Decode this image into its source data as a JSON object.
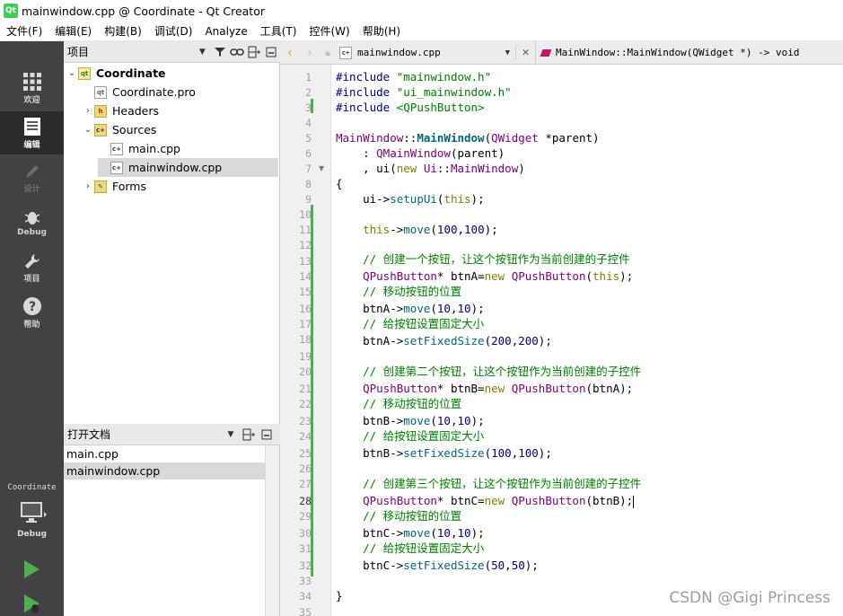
{
  "window": {
    "title": "mainwindow.cpp @ Coordinate - Qt Creator",
    "logo_text": "Qt"
  },
  "menu": [
    "文件(F)",
    "编辑(E)",
    "构建(B)",
    "调试(D)",
    "Analyze",
    "工具(T)",
    "控件(W)",
    "帮助(H)"
  ],
  "modes": [
    {
      "label": "欢迎",
      "icon": "grid-icon"
    },
    {
      "label": "编辑",
      "icon": "edit-icon"
    },
    {
      "label": "设计",
      "icon": "pen-icon"
    },
    {
      "label": "Debug",
      "icon": "bug-icon"
    },
    {
      "label": "项目",
      "icon": "wrench-icon"
    },
    {
      "label": "帮助",
      "icon": "help-icon"
    }
  ],
  "kit": {
    "project": "Coordinate",
    "build": "Debug"
  },
  "project_panel": {
    "title": "项目",
    "tree": [
      {
        "label": "Coordinate",
        "level": 0,
        "icon": "qt-project-icon",
        "bold": true
      },
      {
        "label": "Coordinate.pro",
        "level": 1,
        "icon": "pro-file-icon"
      },
      {
        "label": "Headers",
        "level": 1,
        "icon": "header-folder-icon"
      },
      {
        "label": "Sources",
        "level": 1,
        "icon": "source-folder-icon"
      },
      {
        "label": "main.cpp",
        "level": 2,
        "icon": "cpp-file-icon"
      },
      {
        "label": "mainwindow.cpp",
        "level": 2,
        "icon": "cpp-file-icon",
        "selected": true
      },
      {
        "label": "Forms",
        "level": 1,
        "icon": "forms-folder-icon"
      }
    ]
  },
  "open_docs": {
    "title": "打开文档",
    "items": [
      {
        "label": "main.cpp"
      },
      {
        "label": "mainwindow.cpp",
        "selected": true
      }
    ]
  },
  "editor": {
    "file": "mainwindow.cpp",
    "symbol": "MainWindow::MainWindow(QWidget *) -> void",
    "current_line": 28,
    "line_numbers": [
      "1",
      "2",
      "3",
      "4",
      "5",
      "6",
      "7",
      "8",
      "9",
      "10",
      "11",
      "12",
      "13",
      "14",
      "15",
      "16",
      "17",
      "18",
      "19",
      "20",
      "21",
      "22",
      "23",
      "24",
      "25",
      "26",
      "27",
      "28",
      "29",
      "30",
      "31",
      "32",
      "33",
      "34",
      "35"
    ],
    "comments": {
      "create1": "// 创建一个按钮，让这个按钮作为当前创建的子控件",
      "create2": "// 创建第二个按钮，让这个按钮作为当前创建的子控件",
      "create3": "// 创建第三个按钮，让这个按钮作为当前创建的子控件",
      "move": "// 移动按钮的位置",
      "fixed": "// 给按钮设置固定大小"
    }
  },
  "watermark": "CSDN @Gigi Princess",
  "colors": {
    "modebar": "#424242",
    "changebar": "#4caf50",
    "keyword": "#808000",
    "string": "#008000"
  }
}
